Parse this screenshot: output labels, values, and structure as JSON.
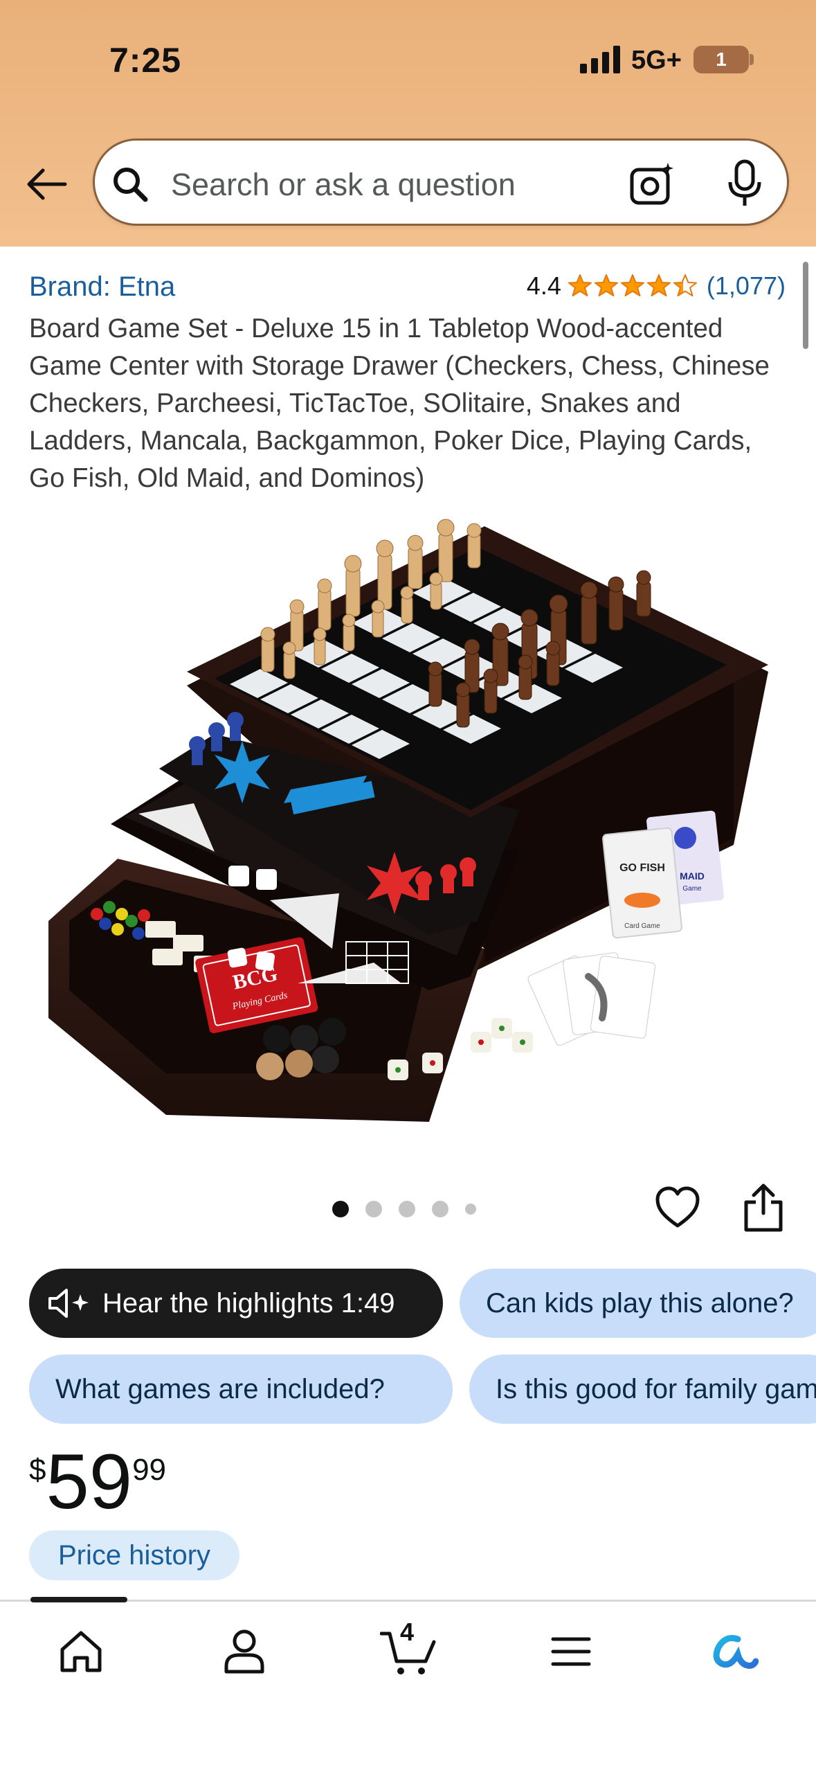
{
  "status_bar": {
    "time": "7:25",
    "network": "5G+",
    "battery": "1"
  },
  "search": {
    "placeholder": "Search or ask a question"
  },
  "product": {
    "brand": "Brand: Etna",
    "rating": "4.4",
    "stars": 4.4,
    "review_count": "(1,077)",
    "title": "Board Game Set - Deluxe 15 in 1 Tabletop Wood-accented Game Center with Storage Drawer (Checkers, Chess, Chinese Checkers, Parcheesi, TicTacToe, SOlitaire, Snakes and Ladders, Mancala, Backgammon, Poker Dice, Playing Cards, Go Fish, Old Maid, and Dominos)",
    "image_pager": {
      "count": 5,
      "active": 1
    }
  },
  "product_image_text": {
    "cards_brand": "BCG",
    "cards_label": "Playing Cards",
    "go_fish": "GO FISH",
    "go_fish_sub": "Card Game",
    "old_maid": "MAID",
    "old_maid_sub": "Game"
  },
  "chips": {
    "hear_highlights": "Hear the highlights 1:49",
    "q1": "Can kids play this alone?",
    "q2": "What games are included?",
    "q3": "Is this good for family game night?"
  },
  "price": {
    "symbol": "$",
    "whole": "59",
    "fraction": "99"
  },
  "price_history": "Price history",
  "bottom_nav": {
    "cart_count": "4"
  },
  "colors": {
    "header": "#f2c08e",
    "link": "#1a5d9b",
    "star": "#ff9900",
    "chip": "#c8ddf9"
  },
  "icons": [
    "back-arrow-icon",
    "search-icon",
    "camera-icon",
    "mic-icon",
    "heart-icon",
    "share-icon",
    "speaker-icon",
    "home-icon",
    "account-icon",
    "cart-icon",
    "menu-icon",
    "rufus-icon"
  ]
}
